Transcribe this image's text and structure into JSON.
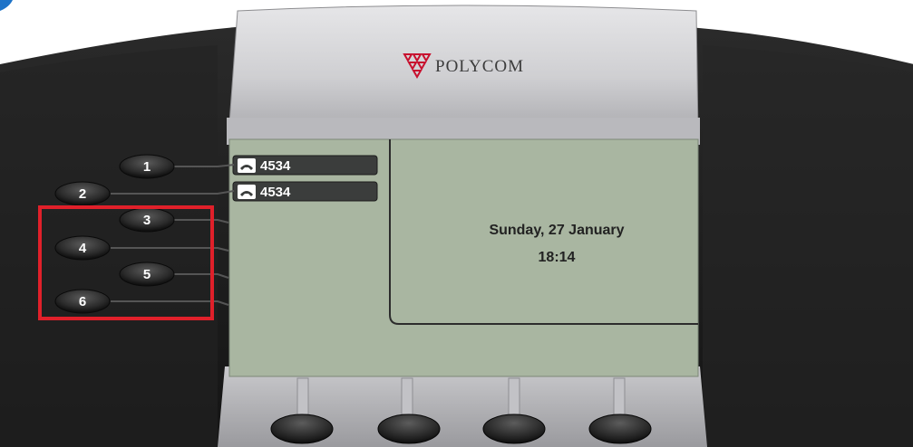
{
  "brand": {
    "name": "POLYCOM",
    "logo_icon": "polycom-triangle-logo-icon",
    "logo_color": "#c8102e"
  },
  "line_keys": [
    {
      "number": "1"
    },
    {
      "number": "2"
    },
    {
      "number": "3"
    },
    {
      "number": "4"
    },
    {
      "number": "5"
    },
    {
      "number": "6"
    }
  ],
  "screen": {
    "background": "#a9b6a1",
    "lines": [
      {
        "icon": "handset-icon",
        "label": "4534"
      },
      {
        "icon": "handset-icon",
        "label": "4534"
      }
    ],
    "idle": {
      "date": "Sunday, 27 January",
      "time": "18:14"
    }
  },
  "soft_keys": [
    {
      "name": "soft-key-1"
    },
    {
      "name": "soft-key-2"
    },
    {
      "name": "soft-key-3"
    },
    {
      "name": "soft-key-4"
    }
  ],
  "highlight": {
    "color": "#e0202a",
    "target": "line keys 3-6"
  }
}
